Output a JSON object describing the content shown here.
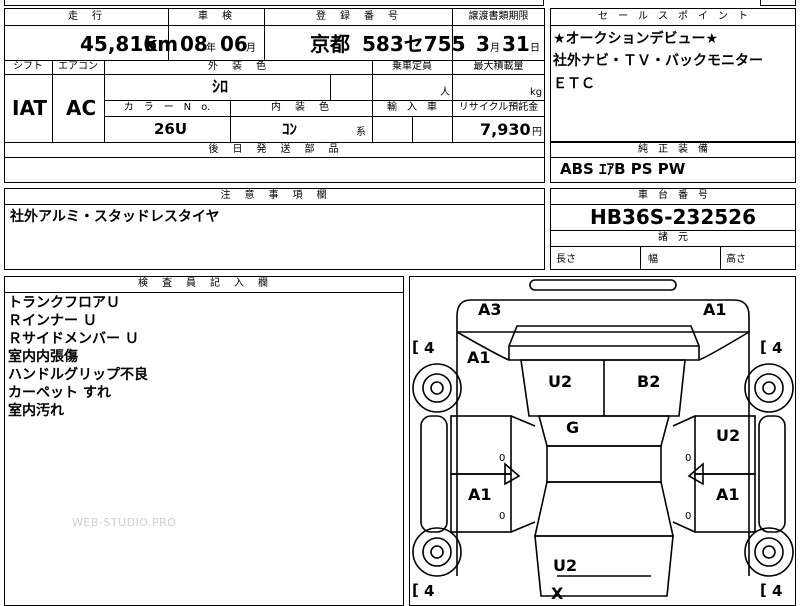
{
  "top_row": {
    "mileage": {
      "label": "走　行",
      "value": "45,816",
      "unit": "km"
    },
    "inspection": {
      "label": "車　検",
      "year": "08",
      "year_unit": "年",
      "month": "06",
      "month_unit": "月"
    },
    "registration": {
      "label": "登　録　番　号",
      "region": "京都",
      "number": "583セ755"
    },
    "transfer_deadline": {
      "label": "譲渡書類期限",
      "day": "3",
      "day_unit": "月",
      "value": "31",
      "value_unit": "日"
    }
  },
  "specs": {
    "shift": {
      "label": "シフト",
      "value": "IAT"
    },
    "aircon": {
      "label": "エアコン",
      "value": "AC"
    },
    "exterior_color": {
      "label": "外　装　色",
      "value": "ｼﾛ"
    },
    "capacity": {
      "label": "乗車定員",
      "unit": "人"
    },
    "max_load": {
      "label": "最大積載量",
      "unit": "kg"
    },
    "color_no": {
      "label": "カ　ラ　ー　N　o.",
      "value": "26U"
    },
    "interior_color": {
      "label": "内　装　色",
      "value": "ｺﾝ",
      "suffix": "系"
    },
    "import": {
      "label": "輸　入　車"
    },
    "recycle_fee": {
      "label": "リサイクル預託金",
      "value": "7,930",
      "unit": "円"
    },
    "later_parts": {
      "label": "後　日　発　送　部　品"
    }
  },
  "sales_points": {
    "label": "セ　ー　ル　ス　ポ　イ　ン　ト",
    "lines": [
      "★オークションデビュー★",
      "社外ナビ・ＴＶ・バックモニター",
      "ＥＴＣ"
    ]
  },
  "standard_equipment": {
    "label": "純　正　装　備",
    "value": "ABS ｴｱB PS PW"
  },
  "notes": {
    "label": "注　意　事　項　欄",
    "value": "社外アルミ・スタッドレスタイヤ"
  },
  "chassis": {
    "label": "車　台　番　号",
    "value": "HB36S-232526"
  },
  "dimensions": {
    "label": "諸　元",
    "length": "長さ",
    "width": "幅",
    "height": "高さ"
  },
  "inspector": {
    "label": "検　査　員　記　入　欄",
    "lines": [
      "トランクフロアＵ",
      "Ｒインナー Ｕ",
      "Ｒサイドメンバー Ｕ",
      "室内内張傷",
      "ハンドルグリップ不良",
      "カーペット すれ",
      "室内汚れ"
    ]
  },
  "watermark": "WEB-STUDIO.PRO",
  "diagram": {
    "bracket_left": "[",
    "bracket_right": "",
    "tire_value": "4",
    "marks": [
      {
        "id": "a3-rear-left",
        "code": "A3"
      },
      {
        "id": "a1-rear-right",
        "code": "A1"
      },
      {
        "id": "a1-left-quarter",
        "code": "A1"
      },
      {
        "id": "u2-trunk-left",
        "code": "U2"
      },
      {
        "id": "b2-trunk-right",
        "code": "B2"
      },
      {
        "id": "g-roof",
        "code": "G"
      },
      {
        "id": "u2-right-door",
        "code": "U2"
      },
      {
        "id": "a1-left-door",
        "code": "A1"
      },
      {
        "id": "a1-right-door",
        "code": "A1"
      },
      {
        "id": "u2-hood",
        "code": "U2"
      },
      {
        "id": "x-front",
        "code": "X"
      }
    ],
    "door_zeros": [
      "0",
      "0",
      "0",
      "0"
    ]
  }
}
